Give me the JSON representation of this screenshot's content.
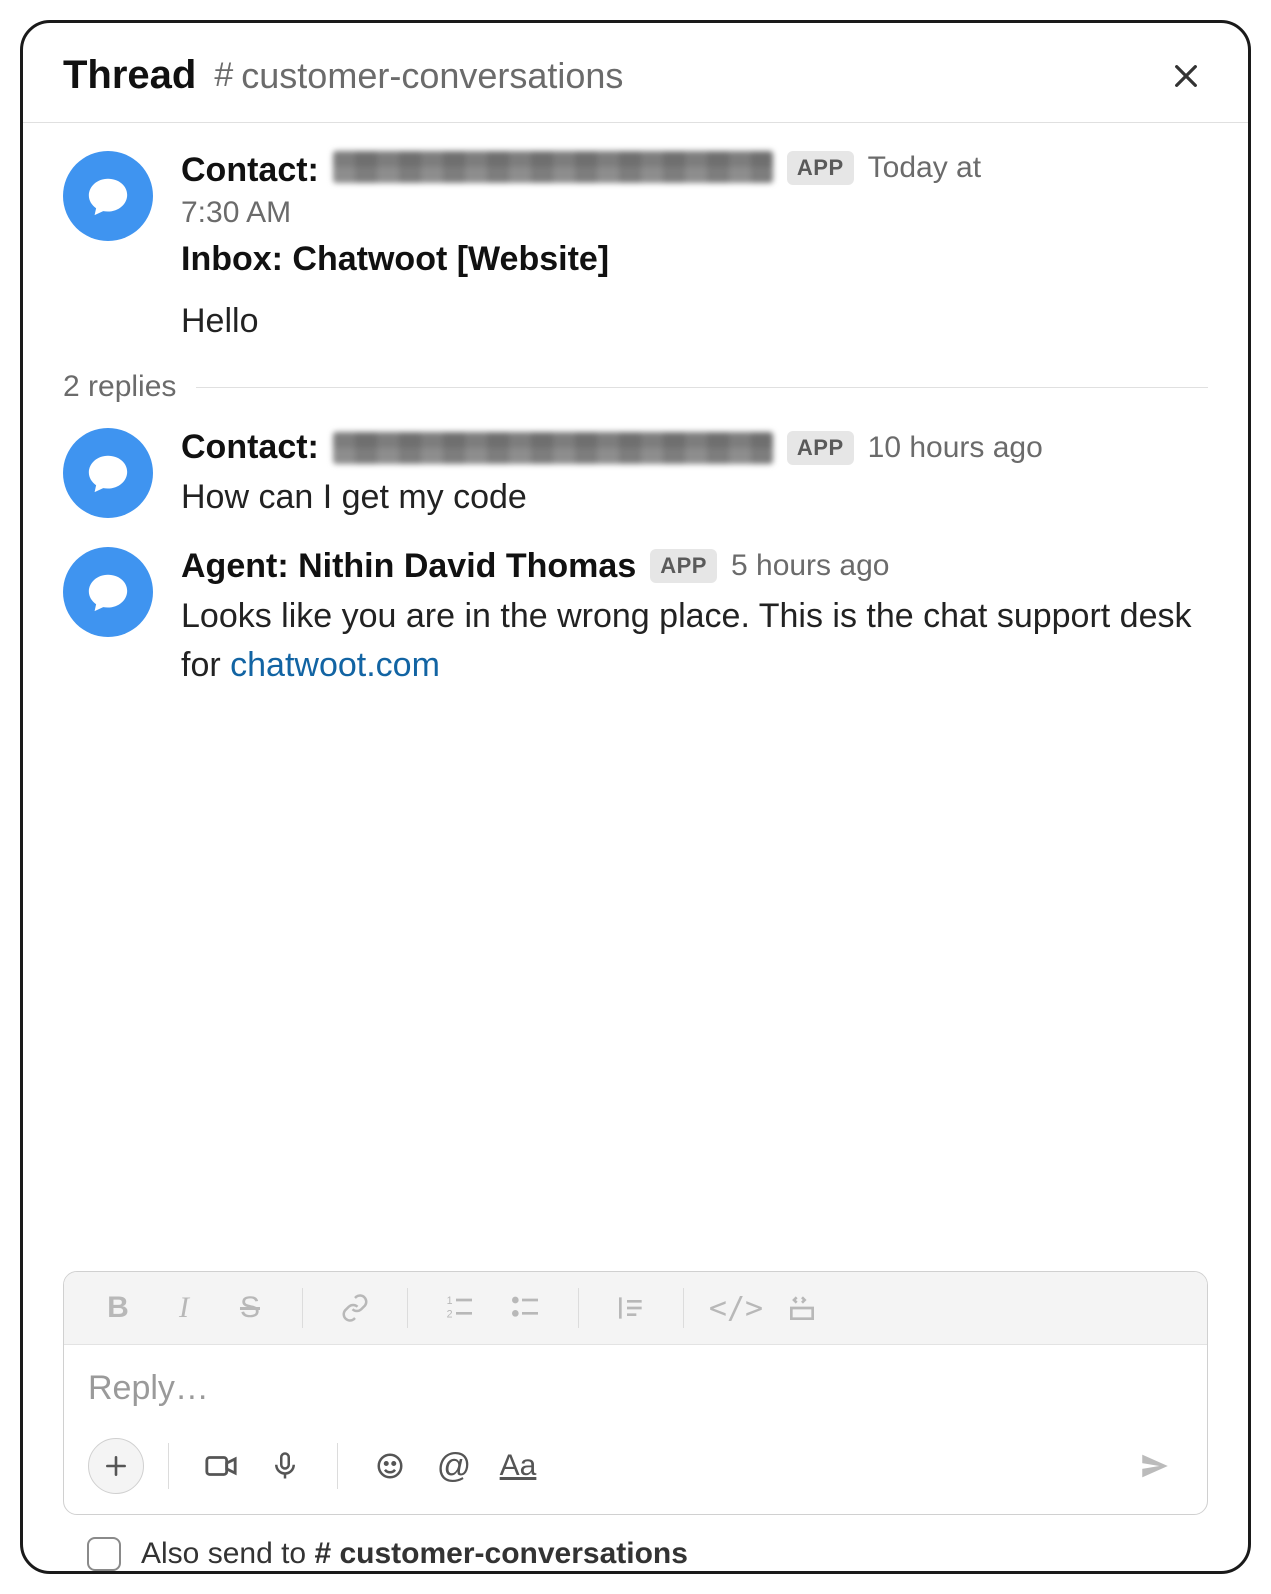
{
  "header": {
    "title": "Thread",
    "channel_prefix": "#",
    "channel_name": "customer-conversations"
  },
  "root_message": {
    "author_label": "Contact:",
    "author_name_redacted": true,
    "app_badge": "APP",
    "time_prefix": "Today at",
    "time": "7:30 AM",
    "inbox_line": "Inbox: Chatwoot [Website]",
    "text": "Hello"
  },
  "replies_label": "2 replies",
  "replies": [
    {
      "author_label": "Contact:",
      "author_name_redacted": true,
      "app_badge": "APP",
      "time": "10 hours ago",
      "text": "How can I get my code"
    },
    {
      "author_label": "Agent: Nithin David Thomas",
      "author_name_redacted": false,
      "app_badge": "APP",
      "time": "5 hours ago",
      "text_before_link": "Looks like you are in the wrong place. This is the chat support desk for ",
      "link_text": "chatwoot.com"
    }
  ],
  "composer": {
    "placeholder": "Reply…"
  },
  "also_send": {
    "prefix": "Also send to ",
    "channel_prefix": "#",
    "channel_name": "customer-conversations"
  }
}
